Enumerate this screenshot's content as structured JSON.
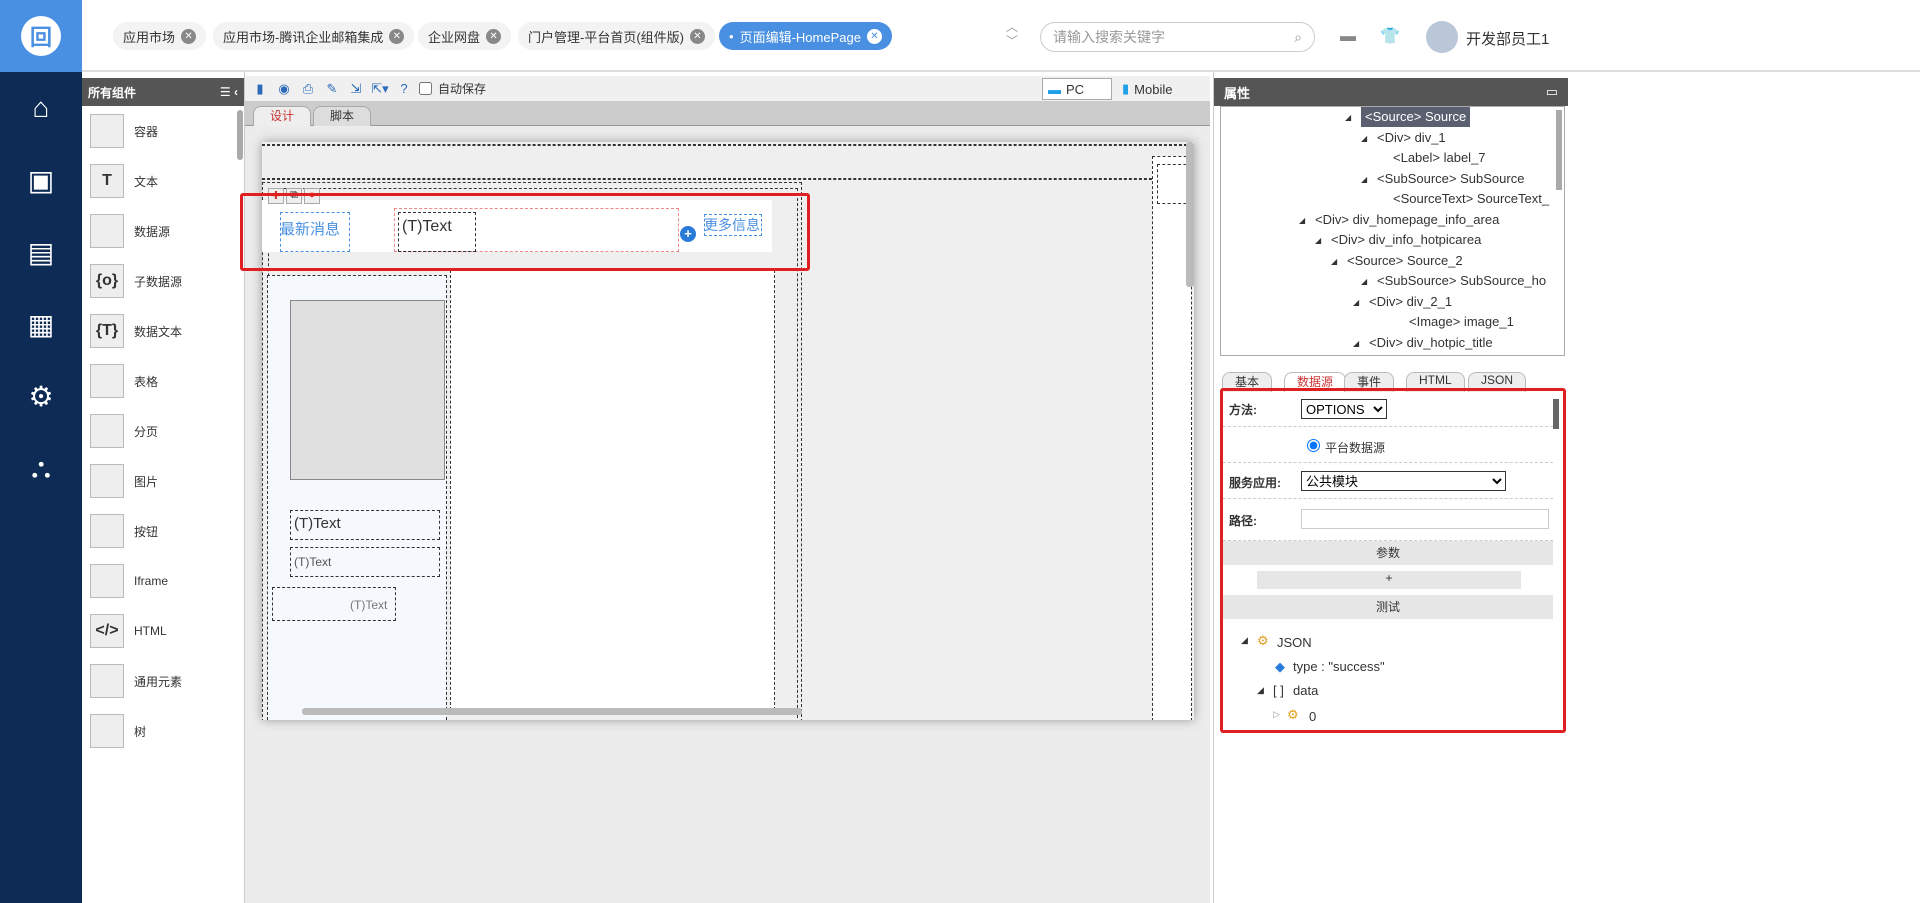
{
  "tabs": [
    {
      "label": "应用市场"
    },
    {
      "label": "应用市场-腾讯企业邮箱集成"
    },
    {
      "label": "企业网盘"
    },
    {
      "label": "门户管理-平台首页(组件版)"
    },
    {
      "label": "页面编辑-HomePage",
      "active": true
    }
  ],
  "search": {
    "placeholder": "请输入搜索关键字"
  },
  "user": {
    "name": "开发部员工1"
  },
  "components": {
    "title": "所有组件",
    "items": [
      {
        "label": "容器",
        "icon": "container-icon"
      },
      {
        "label": "文本",
        "icon": "T"
      },
      {
        "label": "数据源",
        "icon": "datasource-icon"
      },
      {
        "label": "子数据源",
        "icon": "{o}"
      },
      {
        "label": "数据文本",
        "icon": "{T}"
      },
      {
        "label": "表格",
        "icon": "table-icon"
      },
      {
        "label": "分页",
        "icon": "page-icon"
      },
      {
        "label": "图片",
        "icon": "image-icon"
      },
      {
        "label": "按钮",
        "icon": "hand-icon"
      },
      {
        "label": "Iframe",
        "icon": "iframe-icon"
      },
      {
        "label": "HTML",
        "icon": "</>"
      },
      {
        "label": "通用元素",
        "icon": "element-icon"
      },
      {
        "label": "树",
        "icon": "tree-icon"
      }
    ]
  },
  "toolbar": {
    "autosave": "自动保存",
    "pc": "PC",
    "mobile": "Mobile"
  },
  "design_tabs": [
    "设计",
    "脚本"
  ],
  "canvas": {
    "news": "最新消息",
    "text": "(T)Text",
    "more": "更多信息",
    "t1": "(T)Text",
    "t2": "(T)Text",
    "t3": "(T)Text"
  },
  "props": {
    "title": "属性",
    "tree": [
      {
        "label": "<Source> Source",
        "sel": true
      },
      {
        "label": "<Div> div_1"
      },
      {
        "label": "<Label> label_7"
      },
      {
        "label": "<SubSource> SubSource"
      },
      {
        "label": "<SourceText> SourceText_"
      },
      {
        "label": "<Div> div_homepage_info_area"
      },
      {
        "label": "<Div> div_info_hotpicarea"
      },
      {
        "label": "<Source> Source_2"
      },
      {
        "label": "<SubSource> SubSource_ho"
      },
      {
        "label": "<Div> div_2_1"
      },
      {
        "label": "<Image> image_1"
      },
      {
        "label": "<Div> div_hotpic_title"
      }
    ],
    "tabs": [
      "基本",
      "数据源",
      "事件",
      "HTML",
      "JSON"
    ],
    "method_label": "方法:",
    "method": "OPTIONS",
    "platform_ds": "平台数据源",
    "service_label": "服务应用:",
    "service": "公共模块",
    "path_label": "路径:",
    "params": "参数",
    "add": "+",
    "test": "测试",
    "json": {
      "root": "JSON",
      "type": "type : \"success\"",
      "data": "data",
      "idx": "0",
      "arr": "[ ]"
    }
  }
}
